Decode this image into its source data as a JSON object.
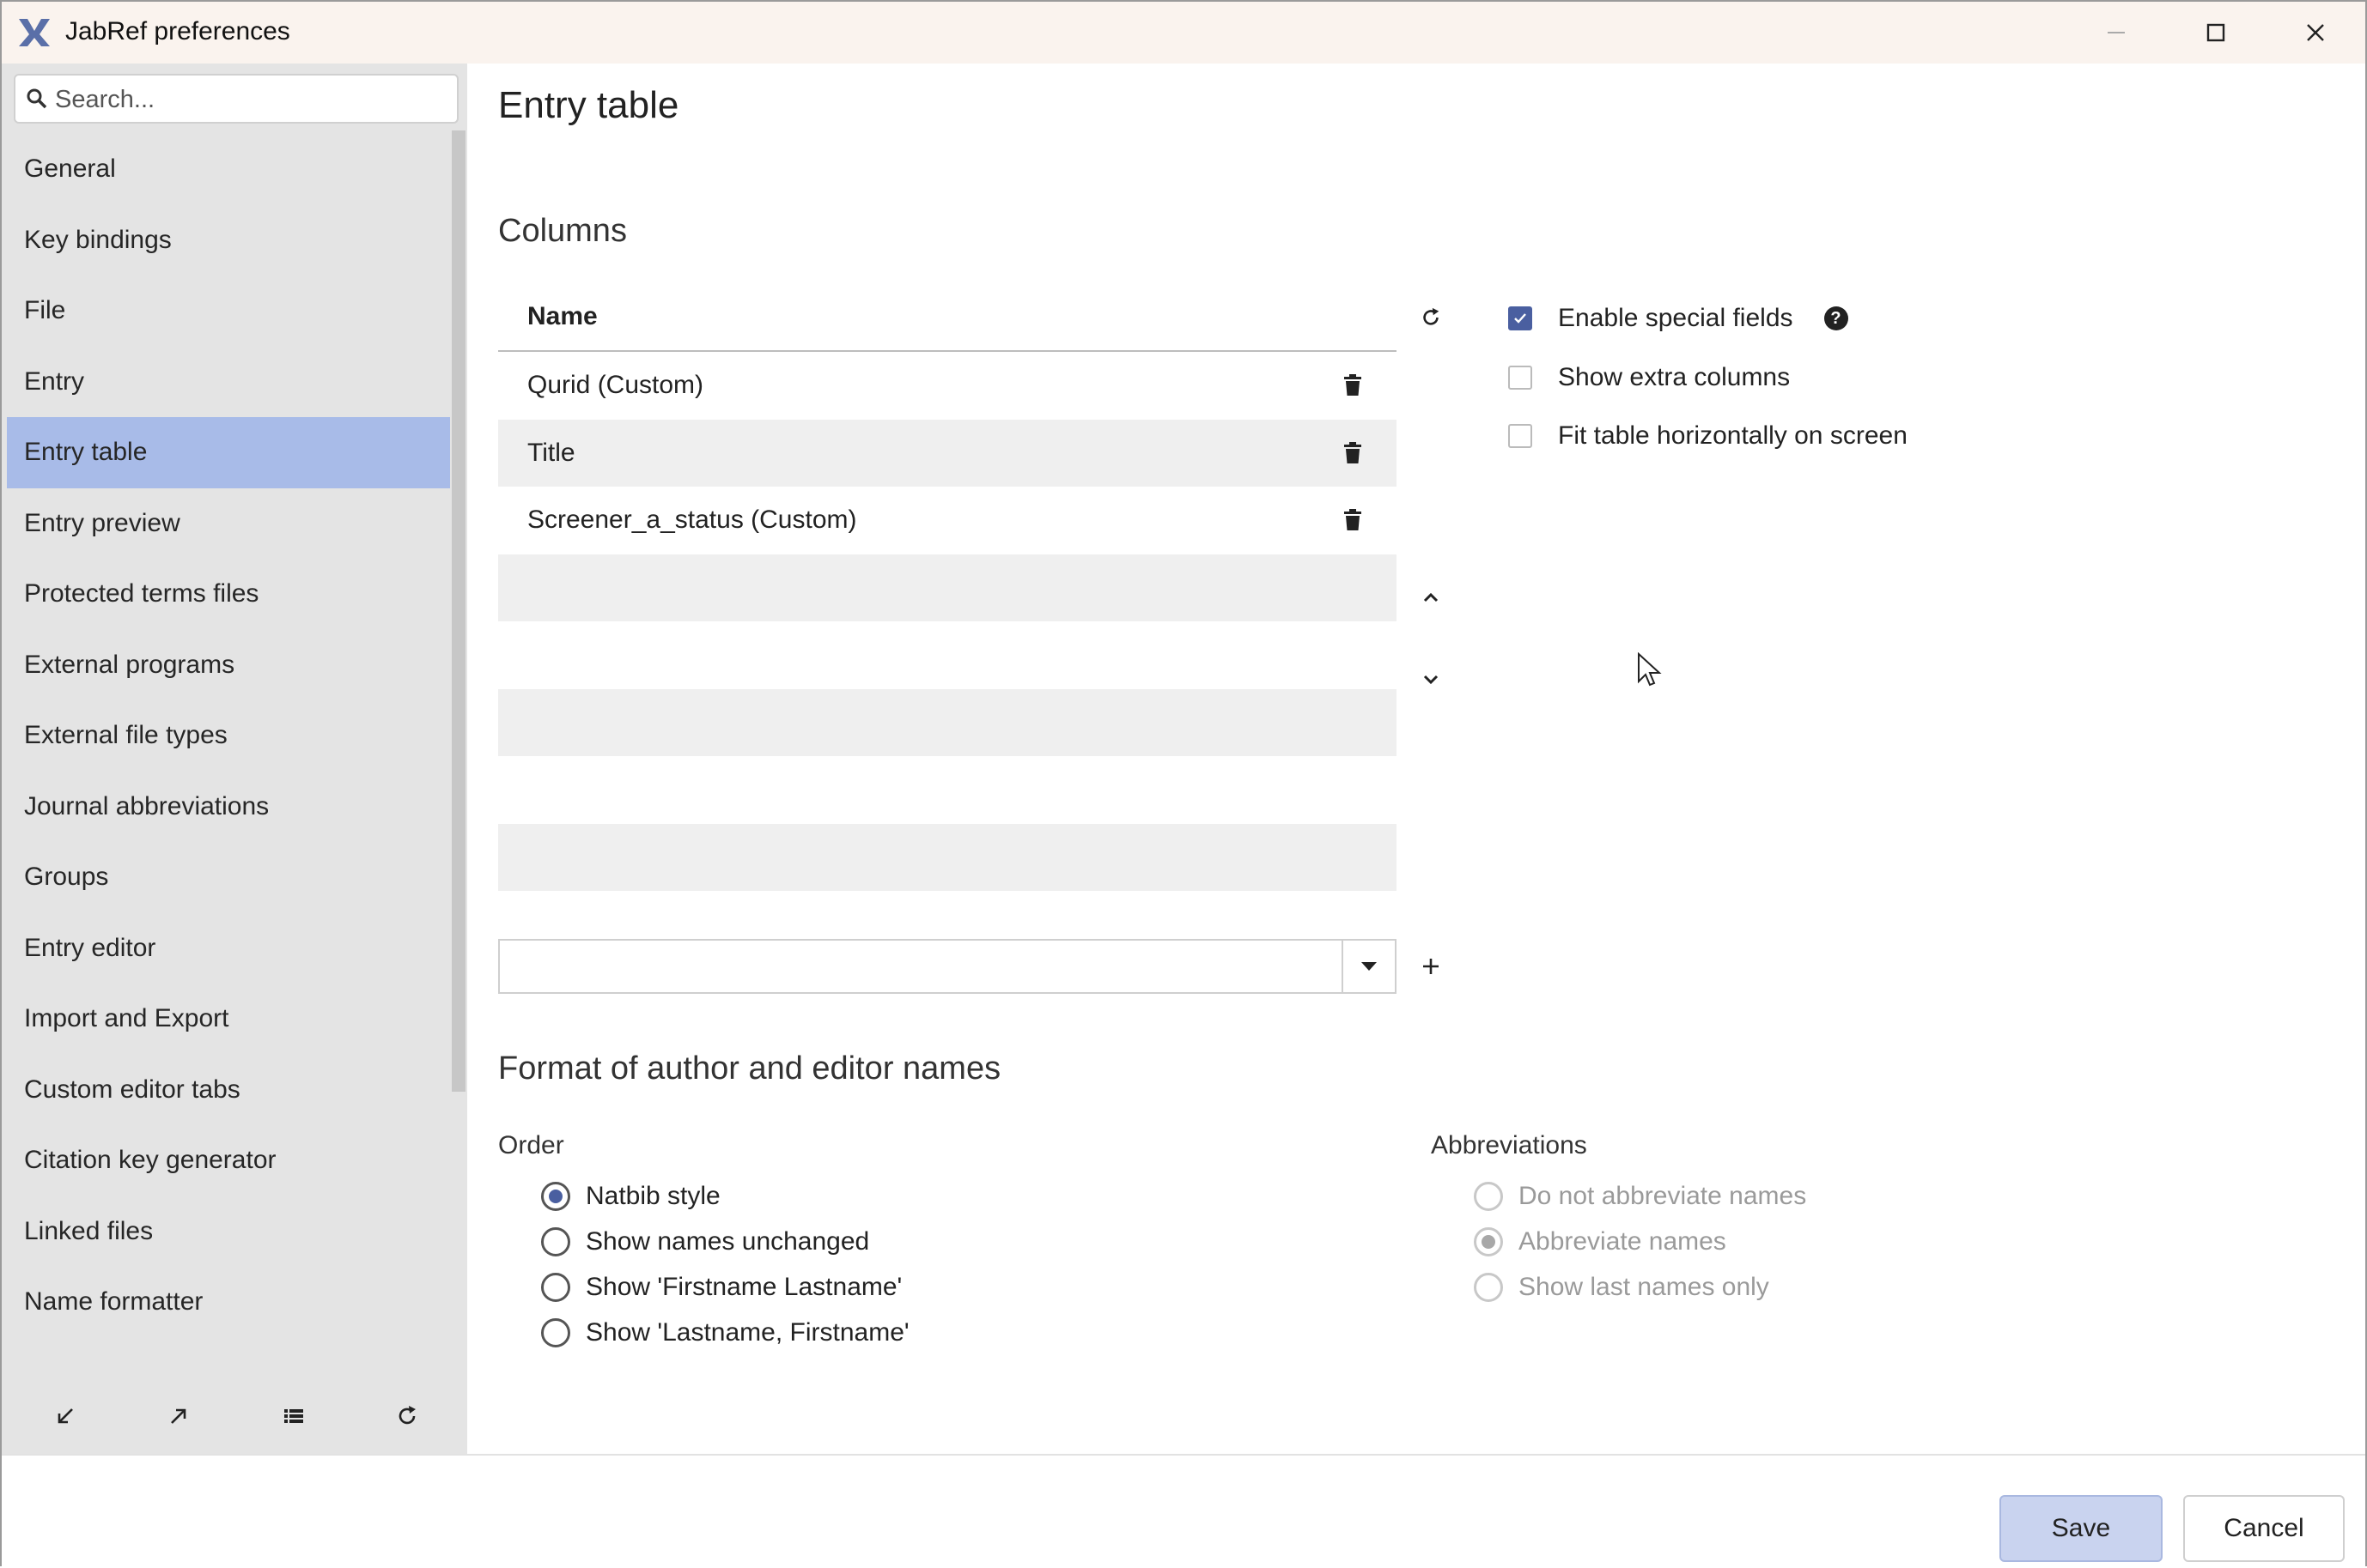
{
  "window": {
    "title": "JabRef preferences",
    "controls": [
      "minimize-icon",
      "maximize-icon",
      "close-icon"
    ]
  },
  "sidebar": {
    "search_placeholder": "Search...",
    "items": [
      {
        "label": "General"
      },
      {
        "label": "Key bindings"
      },
      {
        "label": "File"
      },
      {
        "label": "Entry"
      },
      {
        "label": "Entry table",
        "selected": true
      },
      {
        "label": "Entry preview"
      },
      {
        "label": "Protected terms files"
      },
      {
        "label": "External programs"
      },
      {
        "label": "External file types"
      },
      {
        "label": "Journal abbreviations"
      },
      {
        "label": "Groups"
      },
      {
        "label": "Entry editor"
      },
      {
        "label": "Import and Export"
      },
      {
        "label": "Custom editor tabs"
      },
      {
        "label": "Citation key generator"
      },
      {
        "label": "Linked files"
      },
      {
        "label": "Name formatter"
      }
    ],
    "footer_icons": [
      "import-icon",
      "export-icon",
      "list-icon",
      "reset-icon"
    ]
  },
  "main": {
    "title": "Entry table",
    "columns_heading": "Columns",
    "table": {
      "header": "Name",
      "rows": [
        {
          "name": "Qurid (Custom)"
        },
        {
          "name": "Title"
        },
        {
          "name": "Screener_a_status (Custom)"
        },
        {
          "name": ""
        },
        {
          "name": ""
        },
        {
          "name": ""
        },
        {
          "name": ""
        },
        {
          "name": ""
        }
      ]
    },
    "options": {
      "enable_special_fields": {
        "label": "Enable special fields",
        "checked": true
      },
      "show_extra_columns": {
        "label": "Show extra columns",
        "checked": false
      },
      "fit_table": {
        "label": "Fit table horizontally on screen",
        "checked": false
      }
    },
    "format_heading": "Format of author and editor names",
    "order": {
      "label": "Order",
      "options": [
        {
          "label": "Natbib style",
          "selected": true
        },
        {
          "label": "Show names unchanged",
          "selected": false
        },
        {
          "label": "Show 'Firstname Lastname'",
          "selected": false
        },
        {
          "label": "Show 'Lastname, Firstname'",
          "selected": false
        }
      ]
    },
    "abbreviations": {
      "label": "Abbreviations",
      "options": [
        {
          "label": "Do not abbreviate names",
          "selected": false
        },
        {
          "label": "Abbreviate names",
          "selected": true
        },
        {
          "label": "Show last names only",
          "selected": false
        }
      ]
    }
  },
  "buttons": {
    "save": "Save",
    "cancel": "Cancel"
  },
  "colors": {
    "accent": "#4a5fa0",
    "selection": "#a8bbe8",
    "titlebar": "#faf3ee"
  }
}
